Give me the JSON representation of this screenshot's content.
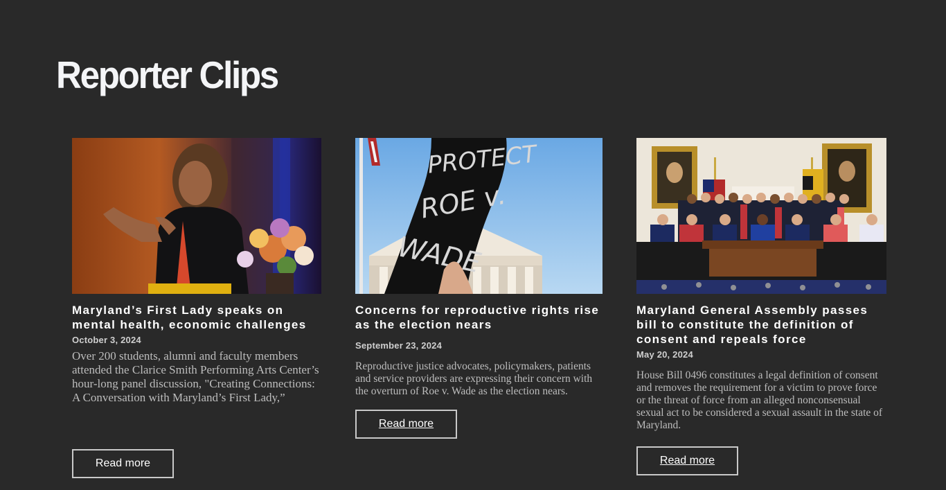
{
  "page": {
    "title": "Reporter Clips"
  },
  "cards": [
    {
      "title": " Maryland’s First Lady speaks on mental health, economic challenges",
      "date": "October 3, 2024",
      "summary": "Over 200 students, alumni and faculty members attended the Clarice Smith Performing Arts Center’s hour-long panel discussion, \"Creating Connections: A Conversation with Maryland’s First Lady,”",
      "button_label": "Read more",
      "image_alt": "Woman speaking on stage beside a flower arrangement"
    },
    {
      "title": "Concerns for reproductive rights rise as the election nears",
      "date": "September 23, 2024",
      "summary": "Reproductive justice advocates, policymakers, patients and service providers are expressing their concern with the overturn of Roe v. Wade as the election nears.",
      "button_label": "Read more",
      "image_alt": "Protest sign reading Protect Roe v. Wade in front of the Supreme Court",
      "sign_text": [
        "PROTECT",
        "ROE v.",
        "WADE"
      ]
    },
    {
      "title": "Maryland General Assembly passes bill to constitute the definition of consent and repeals force",
      "date": "May 20, 2024",
      "summary": "House Bill 0496 constitutes a legal definition of consent and removes the requirement for a victim to prove force or the threat of force from an alleged nonconsensual sexual act to be considered a sexual assault in the state of Maryland.",
      "button_label": "Read more",
      "image_alt": "Group photo of legislators at a bill signing"
    }
  ]
}
